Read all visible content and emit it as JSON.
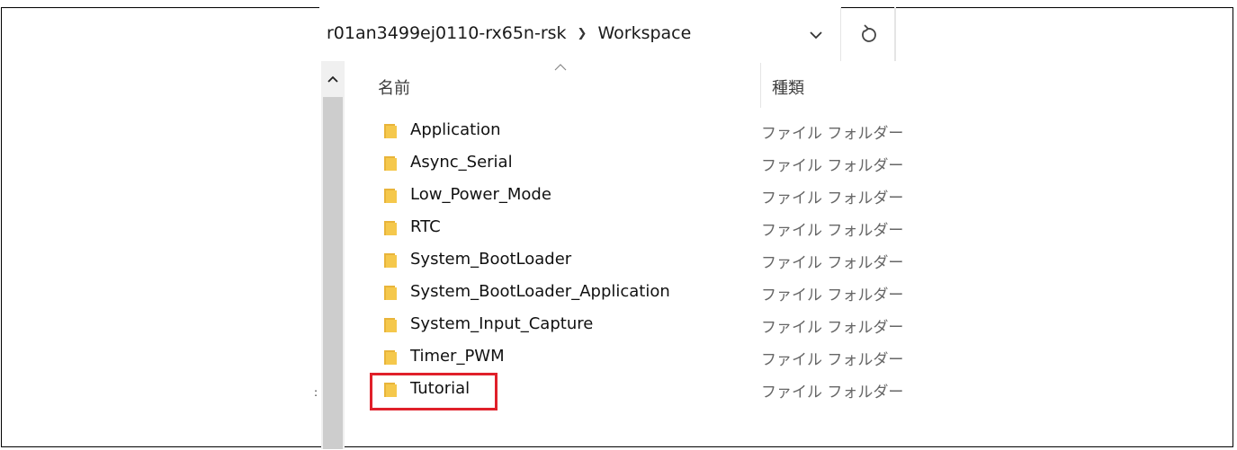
{
  "address": {
    "path_parent": "r01an3499ej0110-rx65n-rsk",
    "path_current": "Workspace"
  },
  "columns": {
    "name": "名前",
    "type": "種類"
  },
  "files": [
    {
      "name": "Application",
      "type": "ファイル フォルダー"
    },
    {
      "name": "Async_Serial",
      "type": "ファイル フォルダー"
    },
    {
      "name": "Low_Power_Mode",
      "type": "ファイル フォルダー"
    },
    {
      "name": "RTC",
      "type": "ファイル フォルダー"
    },
    {
      "name": "System_BootLoader",
      "type": "ファイル フォルダー"
    },
    {
      "name": "System_BootLoader_Application",
      "type": "ファイル フォルダー"
    },
    {
      "name": "System_Input_Capture",
      "type": "ファイル フォルダー"
    },
    {
      "name": "Timer_PWM",
      "type": "ファイル フォルダー"
    },
    {
      "name": "Tutorial",
      "type": "ファイル フォルダー"
    }
  ],
  "highlighted_item": "Tutorial",
  "colors": {
    "folder": "#f5c84c",
    "highlight": "#e0202a"
  }
}
